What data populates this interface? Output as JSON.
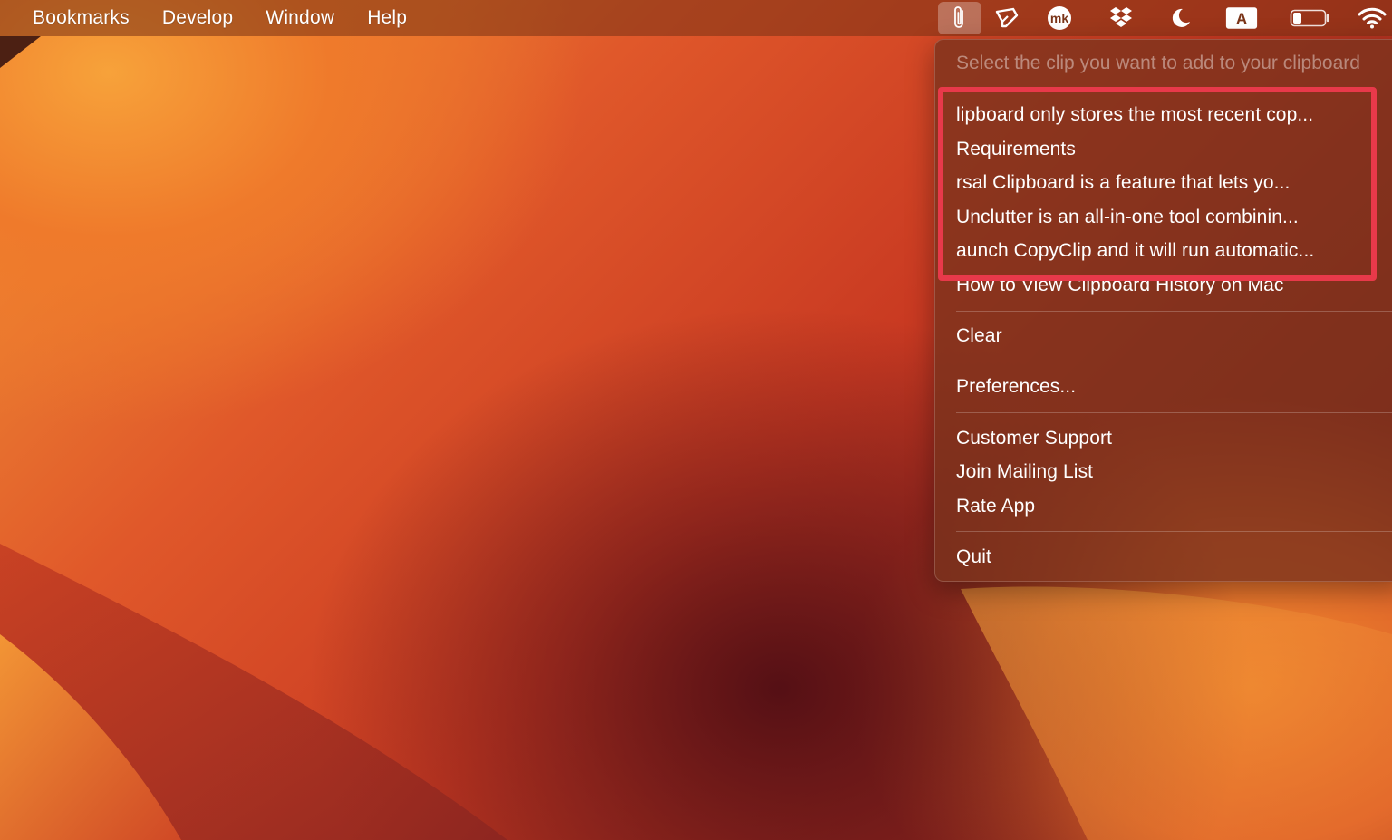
{
  "menubar": {
    "items": [
      "Bookmarks",
      "Develop",
      "Window",
      "Help"
    ]
  },
  "status_icons": [
    {
      "name": "paperclip-icon",
      "active": true
    },
    {
      "name": "pen-tool-icon",
      "active": false
    },
    {
      "name": "mk-app-icon",
      "label": "mk",
      "active": false
    },
    {
      "name": "dropbox-icon",
      "active": false
    },
    {
      "name": "moon-icon",
      "active": false
    },
    {
      "name": "keyboard-input-icon",
      "label": "A",
      "active": false
    },
    {
      "name": "battery-icon",
      "active": false
    },
    {
      "name": "wifi-icon",
      "active": false
    }
  ],
  "dropdown": {
    "header": "Select the clip you want to add to your clipboard",
    "clips": [
      "lipboard only stores the most recent cop...",
      "Requirements",
      "rsal Clipboard is a feature that lets yo...",
      "Unclutter is an all-in-one tool combinin...",
      "aunch CopyClip and it will run automatic...",
      "How to View Clipboard History on Mac"
    ],
    "clear_label": "Clear",
    "preferences_label": "Preferences...",
    "customer_support_label": "Customer Support",
    "mailing_list_label": "Join Mailing List",
    "rate_app_label": "Rate App",
    "quit_label": "Quit"
  },
  "colors": {
    "highlight_border": "#e8394a",
    "menubar_text": "#ffffff",
    "header_text": "#ffffff6b"
  }
}
